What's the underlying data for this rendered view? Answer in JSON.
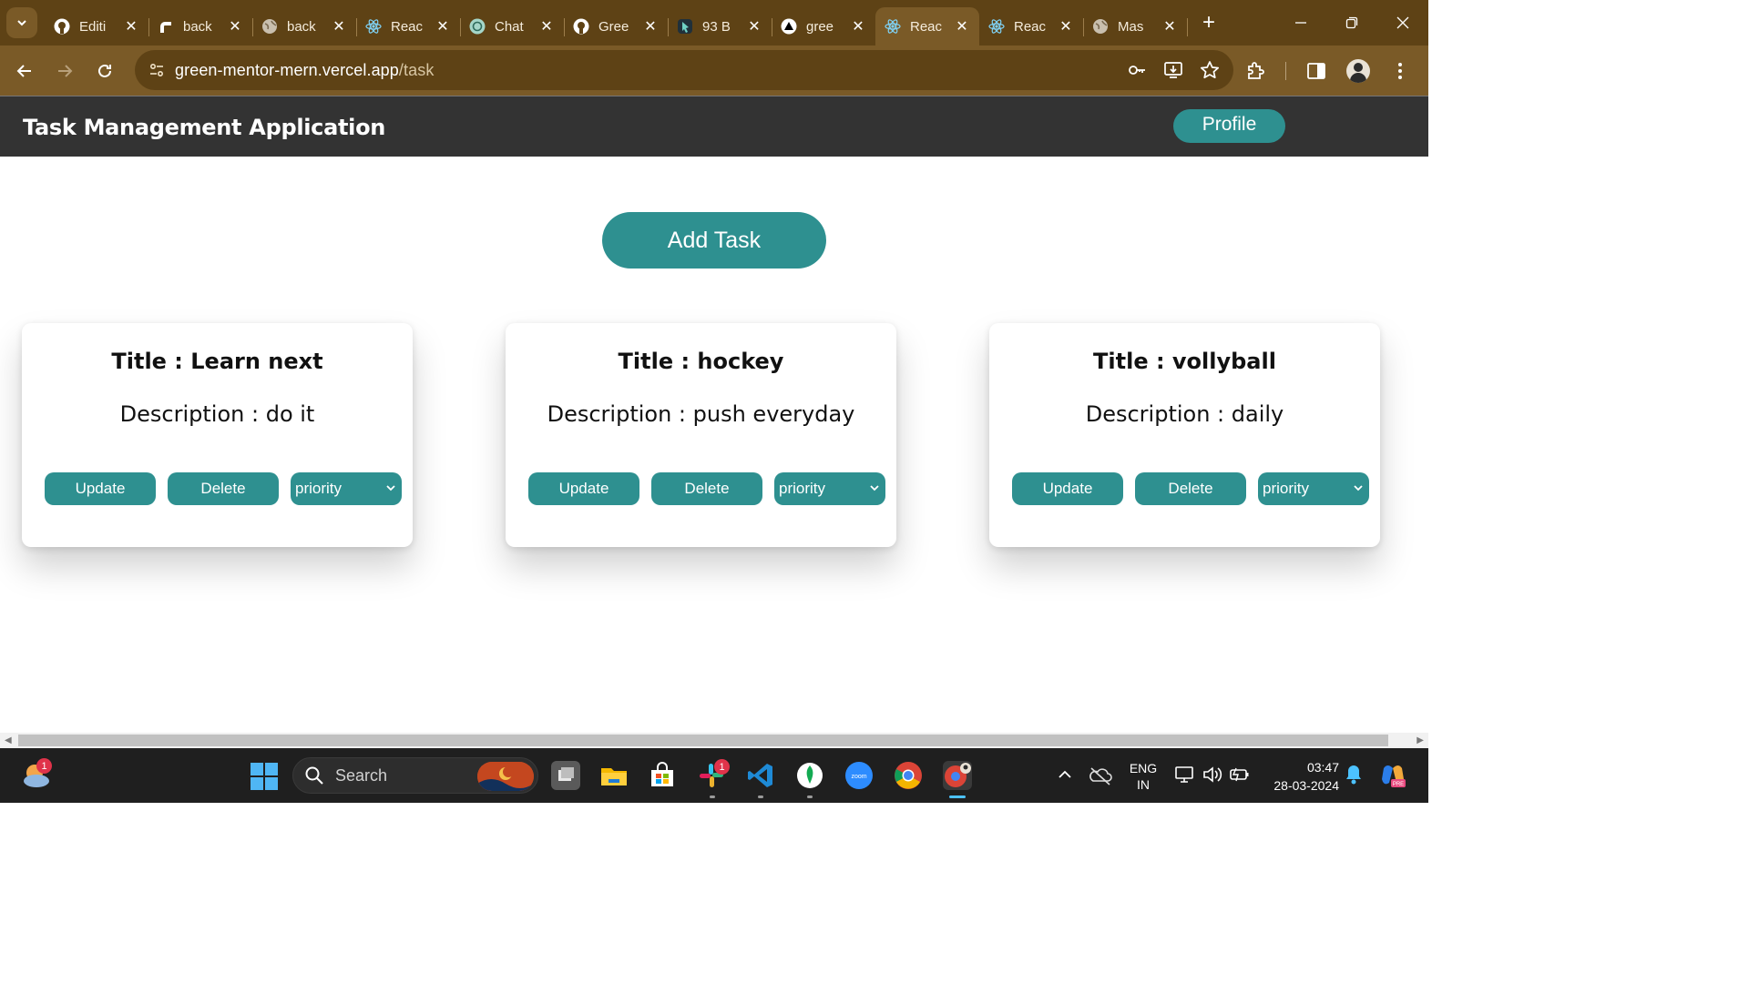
{
  "browser": {
    "tabs": [
      {
        "label": "Editi",
        "icon": "github-icon"
      },
      {
        "label": "back",
        "icon": "render-icon"
      },
      {
        "label": "back",
        "icon": "globe-icon"
      },
      {
        "label": "Reac",
        "icon": "react-icon"
      },
      {
        "label": "Chat",
        "icon": "chatgpt-icon"
      },
      {
        "label": "Gree",
        "icon": "github-icon"
      },
      {
        "label": "93 B",
        "icon": "cursor-app-icon"
      },
      {
        "label": "gree",
        "icon": "vercel-icon"
      },
      {
        "label": "Reac",
        "icon": "react-icon",
        "active": true
      },
      {
        "label": "Reac",
        "icon": "react-icon"
      },
      {
        "label": "Mas",
        "icon": "globe-icon"
      }
    ],
    "url_host": "green-mentor-mern.vercel.app",
    "url_path": "/task"
  },
  "app": {
    "brand": "Task Management Application",
    "profile_label": "Profile",
    "add_task_label": "Add Task",
    "tasks": [
      {
        "title": "Title : Learn next",
        "description": "Description : do it",
        "update_label": "Update",
        "delete_label": "Delete",
        "priority_label": "priority"
      },
      {
        "title": "Title : hockey",
        "description": "Description : push everyday",
        "update_label": "Update",
        "delete_label": "Delete",
        "priority_label": "priority"
      },
      {
        "title": "Title : vollyball",
        "description": "Description : daily",
        "update_label": "Update",
        "delete_label": "Delete",
        "priority_label": "priority"
      }
    ]
  },
  "taskbar": {
    "weather_badge": "1",
    "search_label": "Search",
    "slack_badge": "1",
    "lang_line1": "ENG",
    "lang_line2": "IN",
    "time": "03:47",
    "date": "28-03-2024"
  },
  "colors": {
    "accent": "#2e9090",
    "navbar": "#333333",
    "browser_frame": "#5e4215",
    "browser_toolbar": "#7a5a27"
  }
}
